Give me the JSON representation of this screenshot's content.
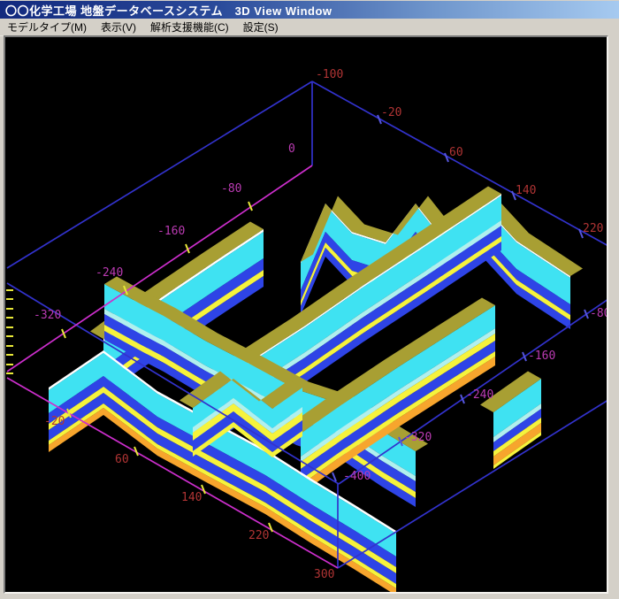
{
  "window": {
    "title": "〇〇化学工場 地盤データベースシステム　3D View Window"
  },
  "menu": {
    "items": [
      {
        "label": "モデルタイプ(M)"
      },
      {
        "label": "表示(V)"
      },
      {
        "label": "解析支援機能(C)"
      },
      {
        "label": "設定(S)"
      }
    ]
  },
  "viewport": {
    "description": "3D fence diagram of soil strata cross sections",
    "axes": {
      "top_edge_labels": [
        "-100",
        "-20",
        "60",
        "140",
        "220"
      ],
      "right_edge_labels": [
        "-80",
        "-160",
        "-240",
        "-320",
        "-400"
      ],
      "mid_axis_labels": [
        "0",
        "-80",
        "-160",
        "-240",
        "-320"
      ],
      "bottom_edge_labels": [
        "-20",
        "60",
        "140",
        "220",
        "300"
      ]
    },
    "colors": {
      "background": "#000000",
      "wire_blue": "#3232cc",
      "wire_magenta": "#cc2ecc",
      "label_red": "#b03434",
      "label_magenta": "#bb3bb3",
      "tick_yellow": "#e8e838",
      "layer_cyan": "#3fe2f2",
      "layer_pale_cyan": "#b0f0ee",
      "layer_blue": "#2e44e6",
      "layer_yellow": "#f6f33c",
      "layer_orange": "#f7a52d",
      "layer_olive": "#a89f33",
      "layer_white": "#ffffff"
    }
  },
  "titlebar_colors": {
    "left": "#12297e",
    "right": "#a6caf0"
  }
}
